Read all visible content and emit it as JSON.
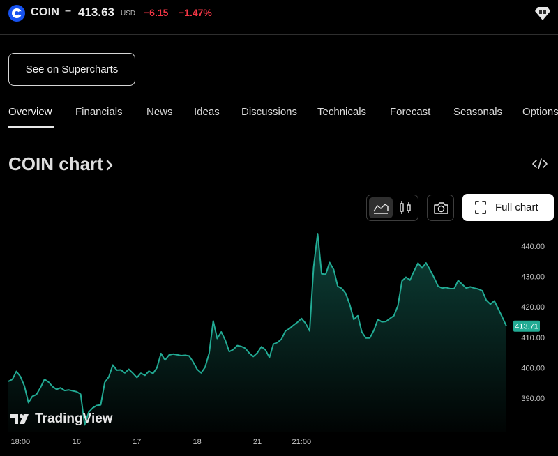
{
  "header": {
    "ticker": "COIN",
    "separator": "−",
    "price": "413.63",
    "currency": "USD",
    "change": "−6.15",
    "change_pct": "−1.47%",
    "logo_icon": "coinbase-logo-icon",
    "badge_icon": "gem-icon"
  },
  "supercharts_button": "See on Supercharts",
  "tabs": [
    {
      "label": "Overview",
      "active": true
    },
    {
      "label": "Financials"
    },
    {
      "label": "News"
    },
    {
      "label": "Ideas"
    },
    {
      "label": "Discussions"
    },
    {
      "label": "Technicals"
    },
    {
      "label": "Forecast"
    },
    {
      "label": "Seasonals"
    },
    {
      "label": "Options"
    }
  ],
  "chart_section": {
    "title": "COIN chart",
    "full_chart_label": "Full chart",
    "embed_icon": "code-embed-icon",
    "area_icon": "area-chart-icon",
    "candle_icon": "candlestick-icon",
    "camera_icon": "camera-icon",
    "fullscreen_icon": "fullscreen-icon",
    "brand": "TradingView"
  },
  "colors": {
    "line": "#22ab94",
    "price_label_bg": "#22ab94",
    "negative": "#f23645",
    "background": "#000000"
  },
  "chart_data": {
    "type": "area",
    "title": "",
    "xlabel": "",
    "ylabel": "",
    "ylim": [
      382,
      447
    ],
    "yticks": [
      390,
      400,
      410,
      420,
      430,
      440
    ],
    "ytick_labels": [
      "390.00",
      "400.00",
      "410.00",
      "420.00",
      "430.00",
      "440.00"
    ],
    "xticks": [
      {
        "label": "18:00",
        "index": 3
      },
      {
        "label": "16",
        "index": 17
      },
      {
        "label": "17",
        "index": 32
      },
      {
        "label": "18",
        "index": 47
      },
      {
        "label": "21",
        "index": 62
      },
      {
        "label": "21:00",
        "index": 73
      }
    ],
    "last_price_label": "413.71",
    "grid": false,
    "series": [
      {
        "values": [
          395.5,
          396.2,
          398.8,
          397.1,
          394.0,
          388.5,
          390.6,
          391.2,
          393.5,
          396.2,
          395.3,
          393.8,
          392.9,
          393.4,
          392.5,
          392.7,
          392.4,
          392.1,
          391.3,
          381.2,
          385.4,
          386.8,
          387.6,
          387.8,
          395.2,
          397.0,
          400.9,
          399.2,
          399.3,
          398.3,
          399.5,
          398.2,
          396.8,
          398.2,
          397.5,
          398.9,
          398.1,
          400.0,
          404.7,
          402.5,
          404.2,
          404.5,
          404.3,
          404.0,
          404.1,
          403.9,
          401.9,
          399.5,
          398.3,
          400.2,
          404.8,
          415.4,
          409.6,
          411.8,
          409.1,
          405.3,
          406.0,
          407.3,
          407.0,
          406.4,
          404.8,
          403.7,
          404.9,
          406.9,
          405.9,
          403.4,
          407.8,
          408.3,
          409.4,
          412.1,
          412.9,
          414.0,
          415.0,
          416.2,
          414.6,
          412.1,
          433.1,
          444.1,
          430.9,
          430.7,
          434.6,
          432.3,
          426.8,
          426.1,
          424.4,
          420.8,
          415.9,
          417.1,
          411.8,
          409.8,
          409.8,
          412.3,
          415.9,
          415.1,
          415.2,
          416.2,
          417.1,
          420.4,
          428.5,
          429.8,
          428.8,
          431.8,
          434.4,
          432.8,
          434.5,
          432.2,
          429.6,
          426.8,
          426.2,
          426.4,
          426.0,
          426.0,
          428.7,
          427.4,
          426.2,
          426.6,
          426.2,
          425.9,
          425.3,
          422.2,
          420.9,
          422.0,
          419.3,
          416.6,
          413.7
        ]
      }
    ]
  }
}
